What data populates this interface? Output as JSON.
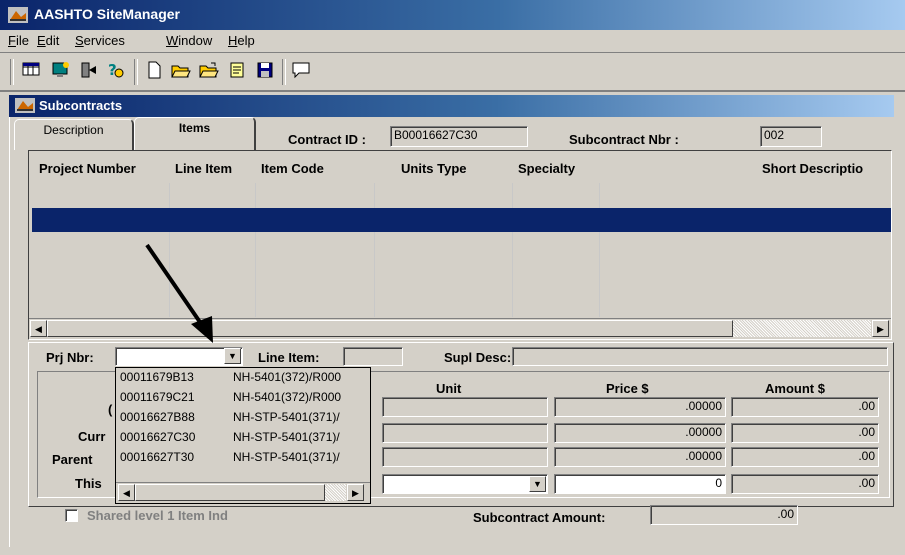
{
  "app": {
    "title": "AASHTO SiteManager"
  },
  "menu": {
    "items": [
      "File",
      "Edit",
      "Services",
      "Window",
      "Help"
    ]
  },
  "toolbar": {
    "icons": [
      "grid-icon",
      "monitor-icon",
      "exit-icon",
      "help-icon",
      "new-document-icon",
      "open-folder-icon",
      "open-folder-alt-icon",
      "notepad-icon",
      "save-icon",
      "comment-icon"
    ]
  },
  "window": {
    "title": "Subcontracts",
    "tabs": [
      {
        "label": "Description"
      },
      {
        "label": "Items"
      }
    ],
    "contract_id_label": "Contract ID :",
    "contract_id": "B00016627C30",
    "subcontract_nbr_label": "Subcontract Nbr :",
    "subcontract_nbr": "002"
  },
  "grid": {
    "columns": [
      "Project Number",
      "Line Item",
      "Item Code",
      "Units Type",
      "Specialty",
      "Short Descriptio"
    ]
  },
  "detail": {
    "prj_nbr_label": "Prj Nbr:",
    "prj_nbr_value": "",
    "line_item_label": "Line Item:",
    "line_item_value": "",
    "supl_desc_label": "Supl Desc:",
    "supl_desc_value": "",
    "col_unit": "Unit",
    "col_price": "Price $",
    "col_amount": "Amount $",
    "partial_row_labels": [
      "(",
      "Curr",
      "Parent",
      "This"
    ],
    "price_values": [
      ".00000",
      ".00000",
      ".00000",
      "0"
    ],
    "amount_values": [
      ".00",
      ".00",
      ".00",
      ".00"
    ],
    "shared_item_label": "Shared level 1 Item Ind",
    "subcontract_amount_label": "Subcontract Amount:",
    "subcontract_amount_value": ".00"
  },
  "dropdown": {
    "options": [
      {
        "id": "00011679B13",
        "desc": "NH-5401(372)/R000"
      },
      {
        "id": "00011679C21",
        "desc": "NH-5401(372)/R000"
      },
      {
        "id": "00016627B88",
        "desc": "NH-STP-5401(371)/"
      },
      {
        "id": "00016627C30",
        "desc": "NH-STP-5401(371)/"
      },
      {
        "id": "00016627T30",
        "desc": "NH-STP-5401(371)/"
      }
    ]
  },
  "colors": {
    "title_bar": "#0a246a",
    "selection": "#0a246a",
    "face": "#d4d0c8"
  }
}
